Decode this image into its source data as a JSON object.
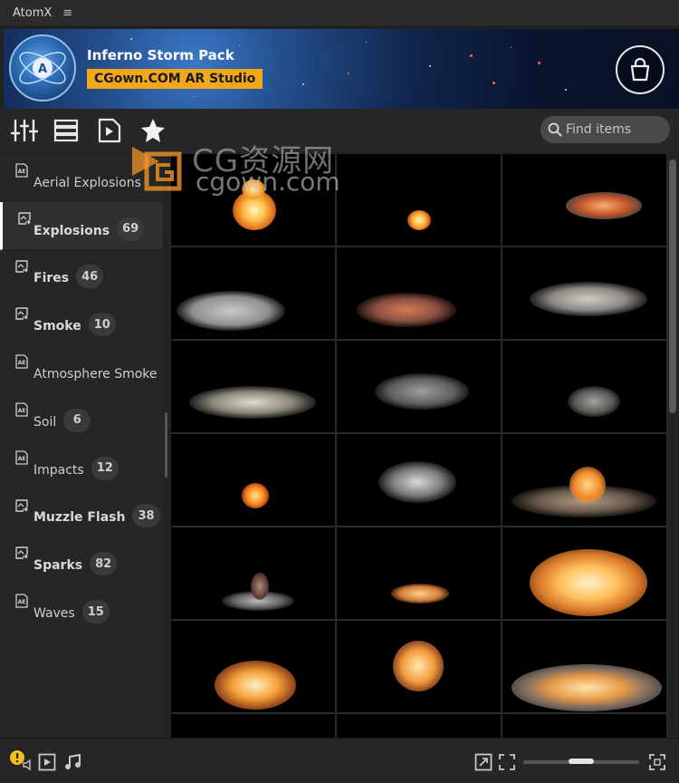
{
  "app": {
    "title": "AtomX",
    "menu_icon": "hamburger-icon"
  },
  "banner": {
    "pack_title": "Inferno Storm Pack",
    "studio": "CGown.COM AR Studio",
    "badge_color": "#f2a71b",
    "logo_letter": "A",
    "cart_icon": "shopping-bag-icon"
  },
  "toolbar": {
    "icons": [
      "sliders-icon",
      "list-layout-icon",
      "play-preview-icon",
      "favorites-star-icon"
    ],
    "search_placeholder": "Find items"
  },
  "categories": [
    {
      "label": "Aerial Explosions",
      "count": null,
      "icon": "ae-file-icon",
      "bold": false,
      "active": false
    },
    {
      "label": "Explosions",
      "count": "69",
      "icon": "image-link-icon",
      "bold": true,
      "active": true
    },
    {
      "label": "Fires",
      "count": "46",
      "icon": "image-link-icon",
      "bold": true,
      "active": false
    },
    {
      "label": "Smoke",
      "count": "10",
      "icon": "image-link-icon",
      "bold": true,
      "active": false
    },
    {
      "label": "Atmosphere Smoke",
      "count": null,
      "icon": "ae-file-icon",
      "bold": false,
      "active": false
    },
    {
      "label": "Soil",
      "count": "6",
      "icon": "ae-file-icon",
      "bold": false,
      "active": false
    },
    {
      "label": "Impacts",
      "count": "12",
      "icon": "ae-file-icon",
      "bold": false,
      "active": false
    },
    {
      "label": "Muzzle Flash",
      "count": "38",
      "icon": "image-link-icon",
      "bold": true,
      "active": false
    },
    {
      "label": "Sparks",
      "count": "82",
      "icon": "image-link-icon",
      "bold": true,
      "active": false
    },
    {
      "label": "Waves",
      "count": "15",
      "icon": "ae-file-icon",
      "bold": false,
      "active": false
    }
  ],
  "watermark": {
    "line1": "CG资源网",
    "line2": "cgown.com"
  },
  "thumbnails": [
    {
      "kind": "fireball-explosion"
    },
    {
      "kind": "small-fireball"
    },
    {
      "kind": "fire-cloud"
    },
    {
      "kind": "white-smoke-cloud"
    },
    {
      "kind": "orange-smoke-cloud"
    },
    {
      "kind": "gray-smoke-plume"
    },
    {
      "kind": "dust-smoke-drift"
    },
    {
      "kind": "gray-smoke-puff"
    },
    {
      "kind": "small-smoke-puff"
    },
    {
      "kind": "small-fireball"
    },
    {
      "kind": "dark-smoke-cloud"
    },
    {
      "kind": "ground-explosion"
    },
    {
      "kind": "ground-dust-burst"
    },
    {
      "kind": "small-ground-fire"
    },
    {
      "kind": "large-fireball"
    },
    {
      "kind": "ground-fireball"
    },
    {
      "kind": "round-fireball"
    },
    {
      "kind": "wide-fire-blast"
    },
    {
      "kind": "empty"
    },
    {
      "kind": "empty"
    },
    {
      "kind": "empty"
    }
  ],
  "bottom_bar": {
    "icons": [
      "warning-icon",
      "audio-volume-icon",
      "play-icon",
      "music-note-icon",
      "export-icon",
      "fit-frame-icon",
      "fullscreen-icon"
    ],
    "thumbnail_size_fraction": 0.5
  }
}
